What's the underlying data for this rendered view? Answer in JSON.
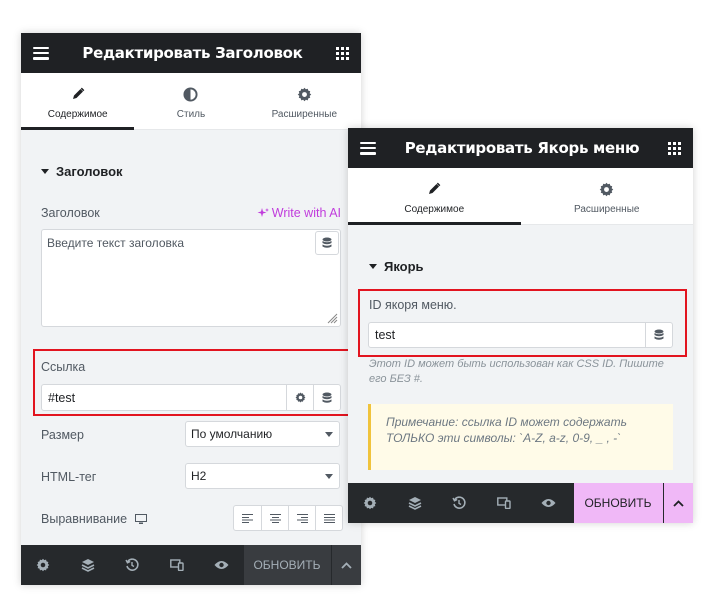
{
  "panel1": {
    "title": "Редактировать Заголовок",
    "tabs": [
      "Содержимое",
      "Стиль",
      "Расширенные"
    ],
    "section_title": "Заголовок",
    "heading_label": "Заголовок",
    "ai_link": "Write with AI",
    "textarea_placeholder": "Введите текст заголовка",
    "link_label": "Ссылка",
    "link_value": "#test",
    "size_label": "Размер",
    "size_value": "По умолчанию",
    "html_tag_label": "HTML-тег",
    "html_tag_value": "H2",
    "align_label": "Выравнивание",
    "update_button": "ОБНОВИТЬ"
  },
  "panel2": {
    "title": "Редактировать Якорь меню",
    "tabs": [
      "Содержимое",
      "Расширенные"
    ],
    "section_title": "Якорь",
    "anchor_label": "ID якоря меню.",
    "anchor_value": "test",
    "help_text": "Этот ID может быть использован как CSS ID. Пишите его БЕЗ #.",
    "note": "Примечание: ссылка ID может содержать ТОЛЬКО эти символы: `A-Z, a-z, 0-9, _ , -`",
    "update_button": "ОБНОВИТЬ"
  },
  "icons": [
    "menu-icon",
    "apps-grid-icon",
    "pencil-icon",
    "contrast-icon",
    "gear-icon",
    "database-icon",
    "layers-icon",
    "history-icon",
    "responsive-icon",
    "eye-icon",
    "desktop-icon",
    "chevron-up-icon",
    "sparkle-icon"
  ],
  "colors": {
    "header_bg": "#1f2124",
    "ai_accent": "#c03cdc",
    "highlight_red": "#e2141f",
    "update_active_bg": "#f0b8f7",
    "note_border": "#f0c33c",
    "note_bg": "#fffbe8"
  }
}
